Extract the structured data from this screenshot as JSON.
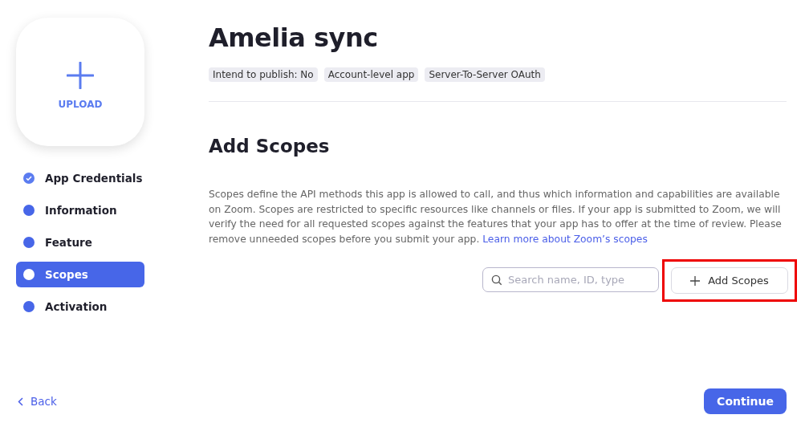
{
  "upload": {
    "label": "UPLOAD"
  },
  "steps": [
    {
      "label": "App Credentials",
      "completed": true,
      "selected": false
    },
    {
      "label": "Information",
      "completed": false,
      "selected": false
    },
    {
      "label": "Feature",
      "completed": false,
      "selected": false
    },
    {
      "label": "Scopes",
      "completed": false,
      "selected": true
    },
    {
      "label": "Activation",
      "completed": false,
      "selected": false
    }
  ],
  "app": {
    "title": "Amelia sync",
    "tags": [
      "Intend to publish: No",
      "Account-level app",
      "Server-To-Server OAuth"
    ]
  },
  "section": {
    "heading": "Add Scopes",
    "description": "Scopes define the API methods this app is allowed to call, and thus which information and capabilities are available on Zoom. Scopes are restricted to specific resources like channels or files. If your app is submitted to Zoom, we will verify the need for all requested scopes against the features that your app has to offer at the time of review. Please remove unneeded scopes before you submit your app.",
    "link": "Learn more about Zoom’s scopes"
  },
  "search": {
    "placeholder": "Search name, ID, type"
  },
  "add_button": {
    "label": "Add Scopes",
    "highlighted": true
  },
  "footer": {
    "back": "Back",
    "continue": "Continue"
  }
}
